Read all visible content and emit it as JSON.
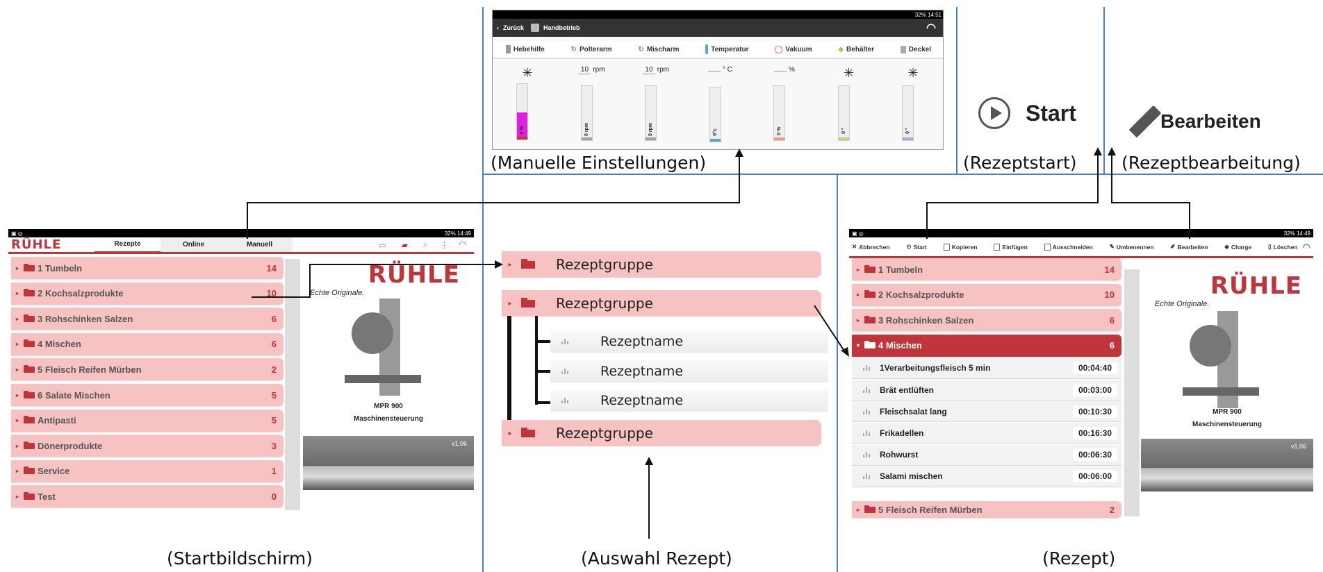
{
  "captions": {
    "manual": "(Manuelle Einstellungen)",
    "start": "(Rezeptstart)",
    "edit": "(Rezeptbearbeitung)",
    "home": "(Startbildschirm)",
    "selection": "(Auswahl Rezept)",
    "recipe": "(Rezept)"
  },
  "detail": {
    "start_label": "Start",
    "edit_label": "Bearbeiten"
  },
  "manual_screen": {
    "status": "32% 14:51",
    "back_label": "Zurück",
    "title": "Handbetrieb",
    "tabs": [
      "Hebehilfe",
      "Polterarm",
      "Mischarm",
      "Temperatur",
      "Vakuum",
      "Behälter",
      "Deckel"
    ],
    "setpoints": [
      "",
      "10",
      "10",
      "",
      "",
      "",
      ""
    ],
    "units": [
      "",
      "rpm",
      "rpm",
      "° C",
      "%",
      "",
      ""
    ],
    "gauge_labels": [
      "0 %",
      "0 rpm",
      "0 rpm",
      "0°c",
      "0 %",
      "0 °",
      "0 °"
    ],
    "gauge_fill": [
      0.5,
      0,
      0,
      0,
      0,
      0,
      0
    ],
    "colors": {
      "magenta": "#e020e0",
      "red": "#c0353b"
    }
  },
  "home_screen": {
    "status": "32% 14:49",
    "logo": "RÜHLE",
    "tabs": [
      "Rezepte",
      "Online",
      "Manuell"
    ],
    "groups": [
      {
        "label": "1 Tumbeln",
        "count": "14"
      },
      {
        "label": "2 Kochsalzprodukte",
        "count": "10"
      },
      {
        "label": "3 Rohschinken Salzen",
        "count": "6"
      },
      {
        "label": "4 Mischen",
        "count": "6"
      },
      {
        "label": "5 Fleisch Reifen Mürben",
        "count": "2"
      },
      {
        "label": "6 Salate Mischen",
        "count": "5"
      },
      {
        "label": "Antipasti",
        "count": "5"
      },
      {
        "label": "Dönerprodukte",
        "count": "3"
      },
      {
        "label": "Service",
        "count": "1"
      },
      {
        "label": "Test",
        "count": "0"
      }
    ],
    "brand_logo": "RÜHLE",
    "tagline": "Echte Originale.",
    "model": "MPR 900",
    "subtitle": "Maschinensteuerung",
    "version": "v1.06"
  },
  "tree": {
    "group_label": "Rezeptgruppe",
    "recipe_label": "Rezeptname"
  },
  "recipe_screen": {
    "status": "32% 14:49",
    "toolbar": [
      "Abbrechen",
      "Start",
      "Kopieren",
      "Einfügen",
      "Ausschneiden",
      "Umbenennen",
      "Bearbeiten",
      "Charge",
      "Löschen"
    ],
    "groups_top": [
      {
        "label": "1 Tumbeln",
        "count": "14"
      },
      {
        "label": "2 Kochsalzprodukte",
        "count": "10"
      },
      {
        "label": "3 Rohschinken Salzen",
        "count": "6"
      }
    ],
    "active_group": {
      "label": "4 Mischen",
      "count": "6"
    },
    "recipes": [
      {
        "name": "1Verarbeitungsfleisch 5 min",
        "time": "00:04:40"
      },
      {
        "name": "Brät entlüften",
        "time": "00:03:00"
      },
      {
        "name": "Fleischsalat lang",
        "time": "00:10:30"
      },
      {
        "name": "Frikadellen",
        "time": "00:16:30"
      },
      {
        "name": "Rohwurst",
        "time": "00:06:30"
      },
      {
        "name": "Salami mischen",
        "time": "00:06:00"
      }
    ],
    "group_bottom": {
      "label": "5 Fleisch Reifen Mürben",
      "count": "2"
    },
    "brand_logo": "RÜHLE",
    "tagline": "Echte Originale.",
    "model": "MPR 900",
    "subtitle": "Maschinensteuerung",
    "version": "v1.06"
  }
}
